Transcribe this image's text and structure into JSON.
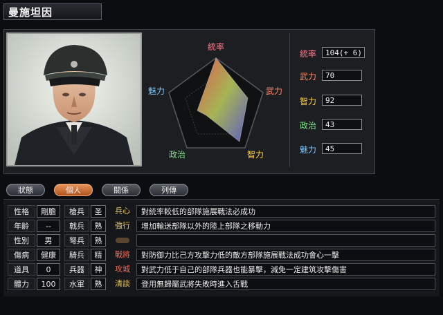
{
  "title": "曼施坦因",
  "stats": [
    {
      "label": "統率",
      "value": "104(+ 6)",
      "color": "#ff7a8a"
    },
    {
      "label": "武力",
      "value": "70",
      "color": "#ff8a6a"
    },
    {
      "label": "智力",
      "value": "92",
      "color": "#ffd24a"
    },
    {
      "label": "政治",
      "value": "43",
      "color": "#7fe08a"
    },
    {
      "label": "魅力",
      "value": "45",
      "color": "#7ec8ff"
    }
  ],
  "radar_labels": {
    "top": "統率",
    "right": "武力",
    "bottom_right": "智力",
    "bottom_left": "政治",
    "left": "魅力"
  },
  "tabs": [
    "狀態",
    "個人",
    "關係",
    "列傳"
  ],
  "active_tab": 1,
  "attributes": [
    {
      "k1": "性格",
      "v1": "剛膽",
      "k2": "槍兵",
      "v2": "圣"
    },
    {
      "k1": "年齡",
      "v1": "--",
      "k2": "戟兵",
      "v2": "熟"
    },
    {
      "k1": "性別",
      "v1": "男",
      "k2": "弩兵",
      "v2": "熟"
    },
    {
      "k1": "傷病",
      "v1": "健康",
      "k2": "騎兵",
      "v2": "精"
    },
    {
      "k1": "道具",
      "v1": "0",
      "k2": "兵器",
      "v2": "神"
    },
    {
      "k1": "體力",
      "v1": "100",
      "k2": "水軍",
      "v2": "熟"
    }
  ],
  "skills": [
    {
      "name": "兵心",
      "desc": "對統率較低的部隊施展戰法必成功"
    },
    {
      "name": "強行",
      "desc": "增加輸送部隊以外的陸上部隊之移動力"
    },
    {
      "name": "",
      "desc": ""
    },
    {
      "name": "戰將",
      "desc": "對防御力比己方攻擊力低的敵方部隊施展戰法成功會心一擊"
    },
    {
      "name": "攻城",
      "desc": "對武力低于自己的部隊兵器也能暴擊，減免一定建筑攻擊傷害"
    },
    {
      "name": "清談",
      "desc": "登用無歸屬武將失敗時進入舌戰"
    }
  ],
  "colors": {
    "accent_tab": "#d07038",
    "skill_name": "#e8c860"
  }
}
